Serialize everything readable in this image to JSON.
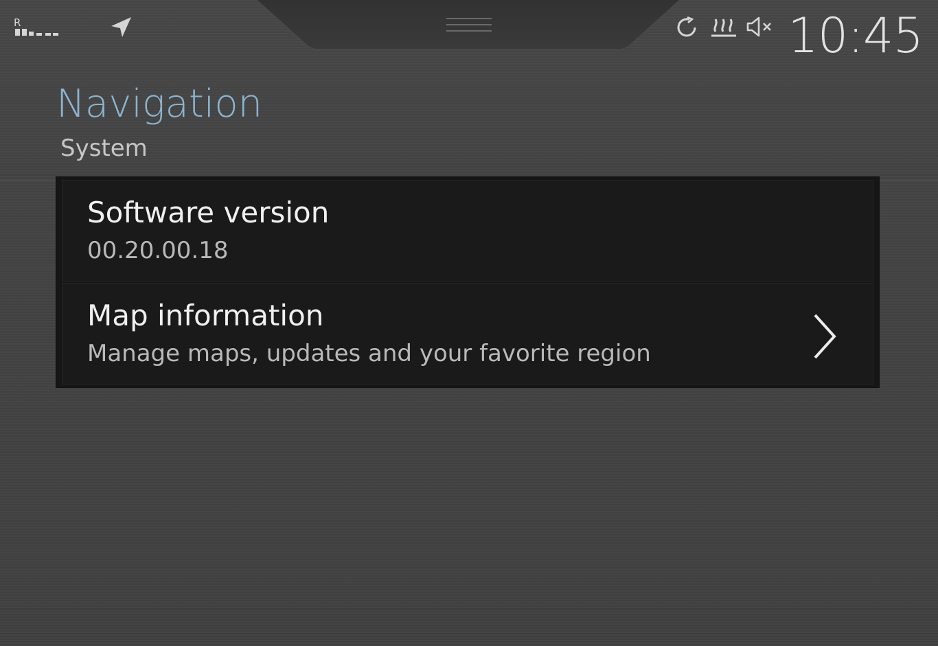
{
  "status_bar": {
    "clock": "10:45",
    "signal_label": "R",
    "icons": [
      "signal-strength-icon",
      "navigation-arrow-icon",
      "sync-icon",
      "rear-defrost-heat-icon",
      "volume-muted-icon"
    ],
    "handle": "pull-down-handle-icon"
  },
  "header": {
    "title": "Navigation",
    "subtitle": "System"
  },
  "list": {
    "items": [
      {
        "title": "Software version",
        "subtitle": "00.20.00.18",
        "has_chevron": false
      },
      {
        "title": "Map information",
        "subtitle": "Manage maps, updates and your favorite region",
        "has_chevron": true
      }
    ]
  },
  "colors": {
    "background": "#434343",
    "accent_title": "#8cb4cf",
    "list_background": "#1a1a1a",
    "primary_text": "#f0f0f0",
    "secondary_text": "#b9b9b9"
  }
}
